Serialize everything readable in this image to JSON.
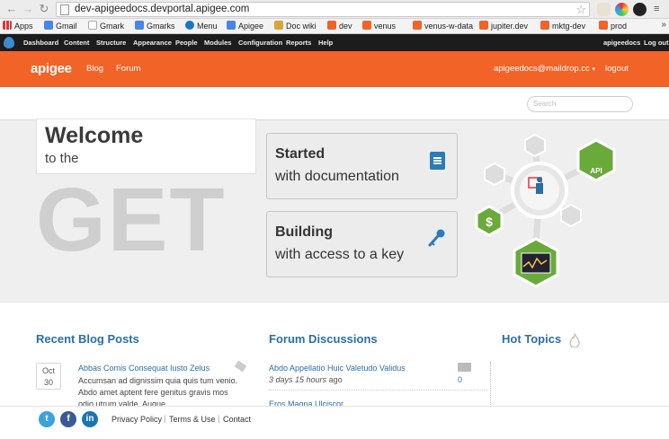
{
  "browser": {
    "url": "dev-apigeedocs.devportal.apigee.com",
    "back_icon": "arrow-left",
    "forward_icon": "arrow-right",
    "reload_icon": "reload",
    "star_icon": "star-outline"
  },
  "bookmarks": [
    {
      "label": "Apps",
      "color": "#e24"
    },
    {
      "label": "Gmail",
      "color": "#4a84e8"
    },
    {
      "label": "Gmark",
      "color": "#ddd"
    },
    {
      "label": "Gmarks",
      "color": "#4a84e8"
    },
    {
      "label": "Menu",
      "color": "#1a78c2"
    },
    {
      "label": "Apigee",
      "color": "#4a84e8"
    },
    {
      "label": "Doc wiki",
      "color": "#d9a43a"
    },
    {
      "label": "dev",
      "color": "#f26327"
    },
    {
      "label": "venus",
      "color": "#f26327"
    },
    {
      "label": "venus-w-data",
      "color": "#f26327"
    },
    {
      "label": "jupiter.dev",
      "color": "#f26327"
    },
    {
      "label": "mktg-dev",
      "color": "#f26327"
    },
    {
      "label": "prod",
      "color": "#f26327"
    }
  ],
  "admin_menu": {
    "items": [
      "Dashboard",
      "Content",
      "Structure",
      "Appearance",
      "People",
      "Modules",
      "Configuration",
      "Reports",
      "Help"
    ],
    "user": "apigeedocs",
    "logout": "Log out"
  },
  "header": {
    "logo": "apigee",
    "nav": [
      "Blog",
      "Forum"
    ],
    "user_email": "apigeedocs@maildrop.cc",
    "logout": "logout",
    "accent_color": "#f26327"
  },
  "search": {
    "placeholder": "Search"
  },
  "hero": {
    "welcome": "Welcome",
    "to_the": "to the",
    "get": "GET",
    "cards": [
      {
        "title": "Started",
        "subtitle": "with documentation",
        "icon": "document-icon"
      },
      {
        "title": "Building",
        "subtitle": "with access to a key",
        "icon": "key-icon"
      }
    ],
    "graphic_label": "API"
  },
  "blog": {
    "title": "Recent Blog Posts",
    "post": {
      "month": "Oct",
      "day": "30",
      "title": "Abbas Comis Consequat Iusto Zelus",
      "excerpt": [
        "Accumsan ad dignissim quia quis tum venio.",
        "Abdo amet aptent fere genitus gravis mos",
        "odio utrum valde. Augue"
      ]
    }
  },
  "forum": {
    "title": "Forum Discussions",
    "items": [
      {
        "title": "Abdo Appellatio Huic Valetudo Validus",
        "age": "3 days 15 hours",
        "age_suffix": "ago",
        "count": "0"
      },
      {
        "title": "Eros Magna Ulciscor",
        "age": "",
        "age_suffix": "",
        "count": ""
      }
    ]
  },
  "hot_topics": {
    "title": "Hot Topics"
  },
  "footer": {
    "links": [
      "Privacy Policy",
      "Terms & Use",
      "Contact"
    ],
    "social": [
      "twitter",
      "facebook",
      "linkedin"
    ]
  }
}
